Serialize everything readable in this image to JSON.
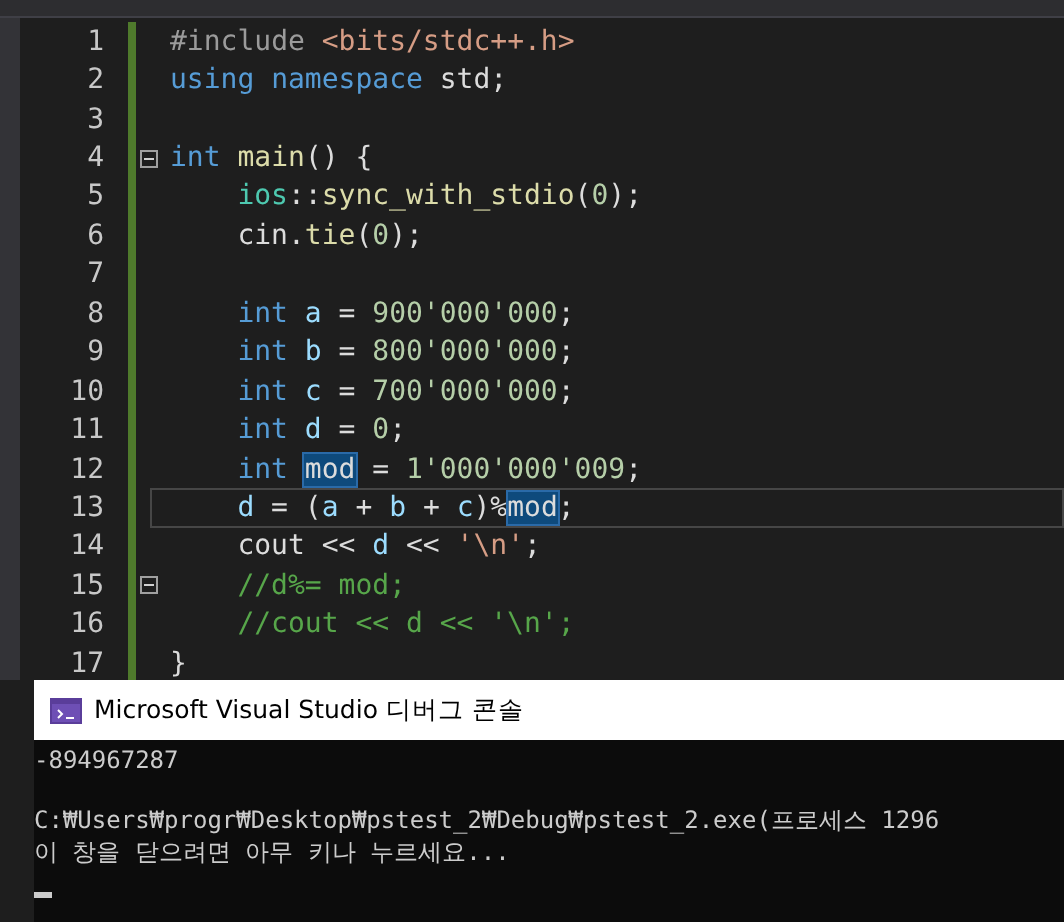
{
  "editor": {
    "lines": [
      {
        "number": "1",
        "fold": false,
        "current": false,
        "indent": false,
        "tokens": [
          {
            "kind": "preproc",
            "text": "#include "
          },
          {
            "kind": "string",
            "text": "<bits/stdc++.h>"
          }
        ]
      },
      {
        "number": "2",
        "fold": false,
        "current": false,
        "indent": false,
        "tokens": [
          {
            "kind": "keyword",
            "text": "using namespace"
          },
          {
            "kind": "plain",
            "text": " std;"
          }
        ]
      },
      {
        "number": "3",
        "fold": false,
        "current": false
      },
      {
        "number": "4",
        "fold": true,
        "current": false,
        "indent": false,
        "tokens": [
          {
            "kind": "keyword",
            "text": "int"
          },
          {
            "kind": "function",
            "text": " main"
          },
          {
            "kind": "plain",
            "text": "() {"
          }
        ]
      },
      {
        "number": "5",
        "fold": false,
        "current": false,
        "indent": true,
        "tokens": [
          {
            "kind": "type",
            "text": "ios"
          },
          {
            "kind": "plain",
            "text": "::"
          },
          {
            "kind": "function",
            "text": "sync_with_stdio"
          },
          {
            "kind": "plain",
            "text": "("
          },
          {
            "kind": "number",
            "text": "0"
          },
          {
            "kind": "plain",
            "text": ");"
          }
        ]
      },
      {
        "number": "6",
        "fold": false,
        "current": false,
        "indent": true,
        "tokens": [
          {
            "kind": "plain",
            "text": "cin."
          },
          {
            "kind": "function",
            "text": "tie"
          },
          {
            "kind": "plain",
            "text": "("
          },
          {
            "kind": "number",
            "text": "0"
          },
          {
            "kind": "plain",
            "text": ");"
          }
        ]
      },
      {
        "number": "7",
        "fold": false,
        "current": false
      },
      {
        "number": "8",
        "fold": false,
        "current": false,
        "indent": true,
        "tokens": [
          {
            "kind": "keyword",
            "text": "int"
          },
          {
            "kind": "variable",
            "text": " a"
          },
          {
            "kind": "plain",
            "text": " = "
          },
          {
            "kind": "number",
            "text": "900'000'000"
          },
          {
            "kind": "plain",
            "text": ";"
          }
        ]
      },
      {
        "number": "9",
        "fold": false,
        "current": false,
        "indent": true,
        "tokens": [
          {
            "kind": "keyword",
            "text": "int"
          },
          {
            "kind": "variable",
            "text": " b"
          },
          {
            "kind": "plain",
            "text": " = "
          },
          {
            "kind": "number",
            "text": "800'000'000"
          },
          {
            "kind": "plain",
            "text": ";"
          }
        ]
      },
      {
        "number": "10",
        "fold": false,
        "current": false,
        "indent": true,
        "tokens": [
          {
            "kind": "keyword",
            "text": "int"
          },
          {
            "kind": "variable",
            "text": " c"
          },
          {
            "kind": "plain",
            "text": " = "
          },
          {
            "kind": "number",
            "text": "700'000'000"
          },
          {
            "kind": "plain",
            "text": ";"
          }
        ]
      },
      {
        "number": "11",
        "fold": false,
        "current": false,
        "indent": true,
        "tokens": [
          {
            "kind": "keyword",
            "text": "int"
          },
          {
            "kind": "variable",
            "text": " d"
          },
          {
            "kind": "plain",
            "text": " = "
          },
          {
            "kind": "number",
            "text": "0"
          },
          {
            "kind": "plain",
            "text": ";"
          }
        ]
      },
      {
        "number": "12",
        "fold": false,
        "current": false,
        "indent": true,
        "tokens": [
          {
            "kind": "keyword",
            "text": "int "
          },
          {
            "kind": "reference",
            "text": "mod"
          },
          {
            "kind": "plain",
            "text": " = "
          },
          {
            "kind": "number",
            "text": "1'000'000'009"
          },
          {
            "kind": "plain",
            "text": ";"
          }
        ]
      },
      {
        "number": "13",
        "fold": false,
        "current": true,
        "indent": true,
        "tokens": [
          {
            "kind": "variable",
            "text": "d"
          },
          {
            "kind": "plain",
            "text": " = ("
          },
          {
            "kind": "variable",
            "text": "a"
          },
          {
            "kind": "plain",
            "text": " + "
          },
          {
            "kind": "variable",
            "text": "b"
          },
          {
            "kind": "plain",
            "text": " + "
          },
          {
            "kind": "variable",
            "text": "c"
          },
          {
            "kind": "plain",
            "text": ")%"
          },
          {
            "kind": "reference",
            "text": "mod"
          },
          {
            "kind": "plain",
            "text": ";"
          }
        ]
      },
      {
        "number": "14",
        "fold": false,
        "current": false,
        "indent": true,
        "tokens": [
          {
            "kind": "plain",
            "text": "cout << "
          },
          {
            "kind": "variable",
            "text": "d"
          },
          {
            "kind": "plain",
            "text": " << "
          },
          {
            "kind": "string",
            "text": "'\\n'"
          },
          {
            "kind": "plain",
            "text": ";"
          }
        ]
      },
      {
        "number": "15",
        "fold": true,
        "current": false,
        "indent": true,
        "tokens": [
          {
            "kind": "comment",
            "text": "//d%= mod;"
          }
        ]
      },
      {
        "number": "16",
        "fold": false,
        "current": false,
        "indent": true,
        "tokens": [
          {
            "kind": "comment",
            "text": "//cout << d << '\\n';"
          }
        ]
      },
      {
        "number": "17",
        "fold": false,
        "current": false,
        "indent": false,
        "tokens": [
          {
            "kind": "plain",
            "text": "}"
          }
        ]
      }
    ]
  },
  "console": {
    "title": "Microsoft Visual Studio 디버그 콘솔",
    "output": [
      "-894967287"
    ],
    "messages": [
      "C:₩Users₩progr₩Desktop₩pstest_2₩Debug₩pstest_2.exe(프로세스 1296",
      "이 창을 닫으려면 아무 키나 누르세요..."
    ]
  }
}
